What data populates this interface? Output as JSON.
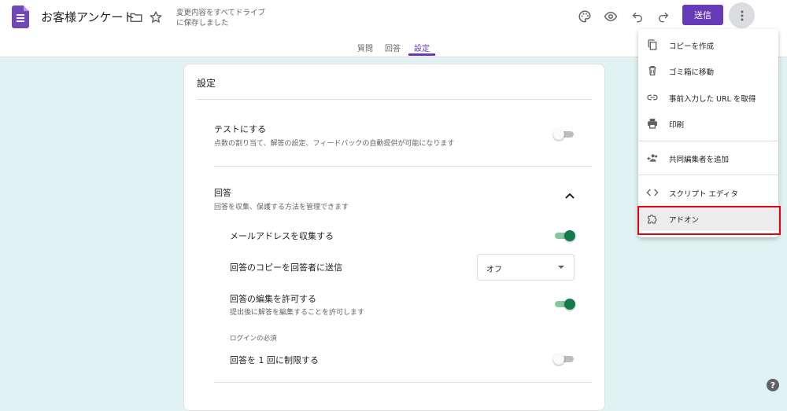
{
  "header": {
    "doc_title": "お客様アンケート",
    "save_status": "変更内容をすべてドライブに保存しました",
    "send_label": "送信"
  },
  "tabs": [
    {
      "label": "質問"
    },
    {
      "label": "回答"
    },
    {
      "label": "設定",
      "active": true
    }
  ],
  "settings": {
    "card_title": "設定",
    "quiz": {
      "title": "テストにする",
      "desc": "点数の割り当て、解答の設定、フィードバックの自動提供が可能になります",
      "enabled": false
    },
    "responses": {
      "title": "回答",
      "desc": "回答を収集、保護する方法を管理できます",
      "collect_email": {
        "label": "メールアドレスを収集する",
        "enabled": true
      },
      "send_copy": {
        "label": "回答のコピーを回答者に送信",
        "value": "オフ"
      },
      "allow_edit": {
        "label": "回答の編集を許可する",
        "desc": "提出後に解答を編集することを許可します",
        "enabled": true
      },
      "login_required_heading": "ログインの必須",
      "limit_one": {
        "label": "回答を 1 回に制限する",
        "enabled": false
      }
    }
  },
  "menu": {
    "items": [
      {
        "label": "コピーを作成",
        "icon": "copy-icon"
      },
      {
        "label": "ゴミ箱に移動",
        "icon": "trash-icon"
      },
      {
        "label": "事前入力した URL を取得",
        "icon": "link-icon"
      },
      {
        "label": "印刷",
        "icon": "print-icon"
      },
      {
        "label": "共同編集者を追加",
        "icon": "add-people-icon"
      },
      {
        "label": "スクリプト エディタ",
        "icon": "code-icon"
      },
      {
        "label": "アドオン",
        "icon": "puzzle-icon"
      }
    ]
  },
  "colors": {
    "accent": "#673ab7",
    "background": "#e0f2f1",
    "toggle_on": "#137a4f",
    "highlight_border": "#e60012"
  }
}
